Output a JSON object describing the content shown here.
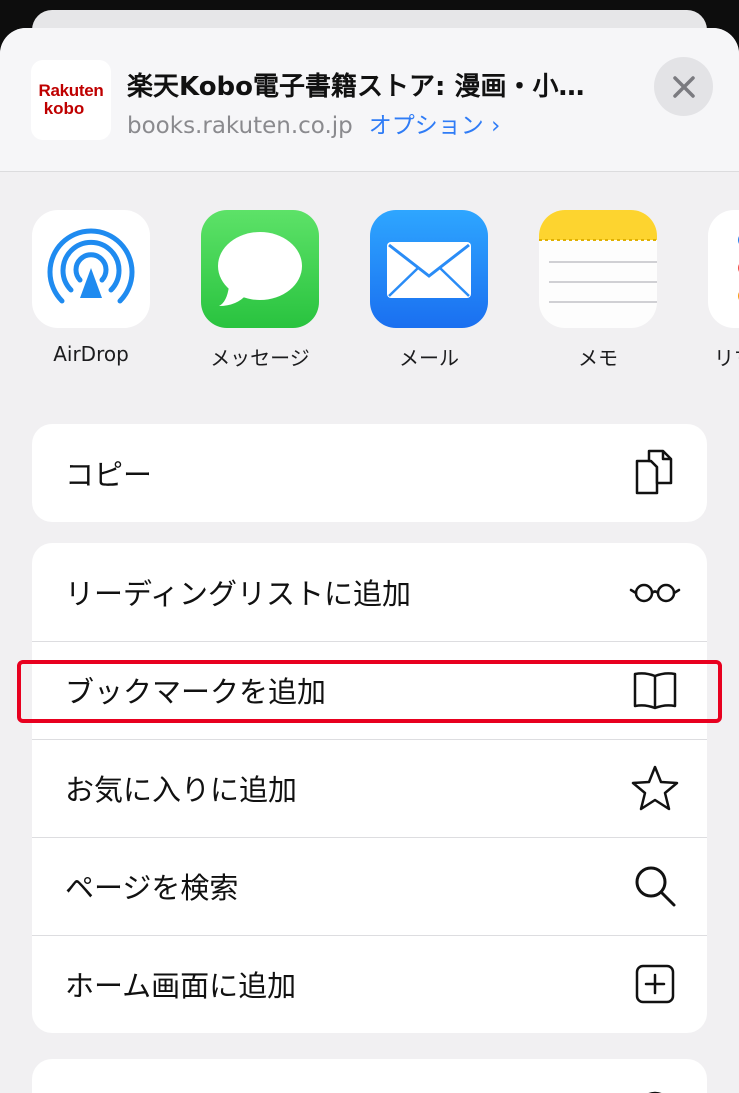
{
  "header": {
    "logo_line1": "Rakuten",
    "logo_line2": "kobo",
    "title": "楽天Kobo電子書籍ストア: 漫画・小…",
    "domain": "books.rakuten.co.jp",
    "options_label": "オプション ›",
    "close_icon": "close-icon"
  },
  "apps": [
    {
      "label": "AirDrop",
      "icon": "airdrop-icon"
    },
    {
      "label": "メッセージ",
      "icon": "messages-icon"
    },
    {
      "label": "メール",
      "icon": "mail-icon"
    },
    {
      "label": "メモ",
      "icon": "notes-icon"
    },
    {
      "label": "リマ",
      "icon": "reminders-icon"
    }
  ],
  "actions_group1": [
    {
      "label": "コピー",
      "icon": "copy-icon"
    }
  ],
  "actions_group2": [
    {
      "label": "リーディングリストに追加",
      "icon": "glasses-icon"
    },
    {
      "label": "ブックマークを追加",
      "icon": "book-icon"
    },
    {
      "label": "お気に入りに追加",
      "icon": "star-icon"
    },
    {
      "label": "ページを検索",
      "icon": "search-icon"
    },
    {
      "label": "ホーム画面に追加",
      "icon": "plus-square-icon"
    }
  ],
  "colors": {
    "brand_red": "#bf0000",
    "link_blue": "#2f7cf6",
    "highlight_red": "#e8001f"
  }
}
